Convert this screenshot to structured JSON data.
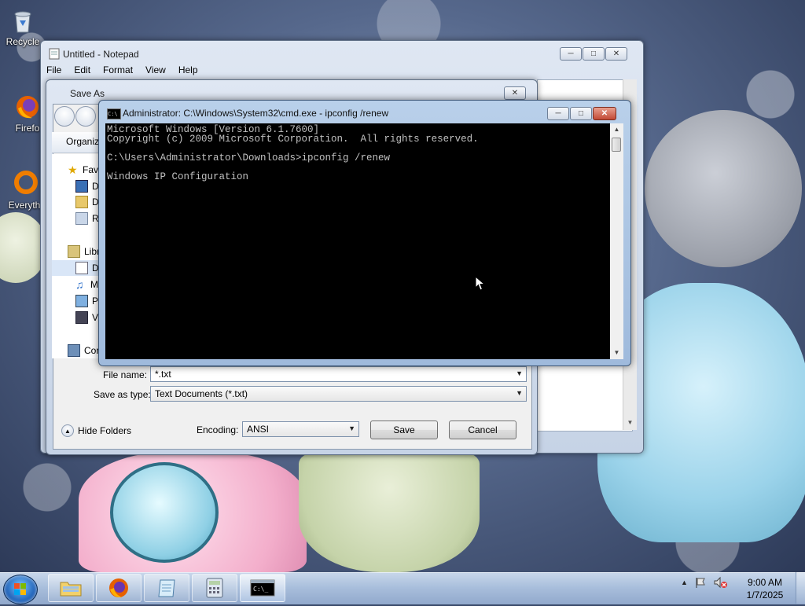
{
  "desktop": {
    "icons": [
      {
        "label": "Recycle"
      },
      {
        "label": "Firefo"
      },
      {
        "label": "Everyth"
      }
    ]
  },
  "notepad": {
    "title": "Untitled - Notepad",
    "menu": [
      "File",
      "Edit",
      "Format",
      "View",
      "Help"
    ]
  },
  "save_as": {
    "title": "Save As",
    "organize_label": "Organiz",
    "nav_items": [
      {
        "label": "Fav",
        "icon": "star-icon"
      },
      {
        "label": "D",
        "icon": "desktop-icon"
      },
      {
        "label": "D",
        "icon": "downloads-icon"
      },
      {
        "label": "R",
        "icon": "recent-places-icon"
      },
      {
        "label": "Libr",
        "icon": "libraries-icon"
      },
      {
        "label": "D",
        "icon": "documents-icon"
      },
      {
        "label": "M",
        "icon": "music-icon"
      },
      {
        "label": "P",
        "icon": "pictures-icon"
      },
      {
        "label": "V",
        "icon": "videos-icon"
      },
      {
        "label": "Cor",
        "icon": "computer-icon"
      }
    ],
    "file_name_label": "File name:",
    "file_name_value": "*.txt",
    "save_type_label": "Save as type:",
    "save_type_value": "Text Documents (*.txt)",
    "hide_folders_label": "Hide Folders",
    "encoding_label": "Encoding:",
    "encoding_value": "ANSI",
    "save_button": "Save",
    "cancel_button": "Cancel"
  },
  "cmd": {
    "title": "Administrator: C:\\Windows\\System32\\cmd.exe - ipconfig  /renew",
    "icon_text": "C:\\",
    "lines": [
      "Microsoft Windows [Version 6.1.7600]",
      "Copyright (c) 2009 Microsoft Corporation.  All rights reserved.",
      "",
      "C:\\Users\\Administrator\\Downloads>ipconfig /renew",
      "",
      "Windows IP Configuration"
    ]
  },
  "taskbar": {
    "time": "9:00 AM",
    "date": "1/7/2025",
    "buttons": [
      "windows-explorer",
      "firefox",
      "notepad",
      "calculator",
      "command-prompt"
    ],
    "active": "command-prompt"
  },
  "colors": {
    "console_bg": "#000000",
    "console_fg": "#c0c0c0",
    "close_red": "#c24a36"
  }
}
